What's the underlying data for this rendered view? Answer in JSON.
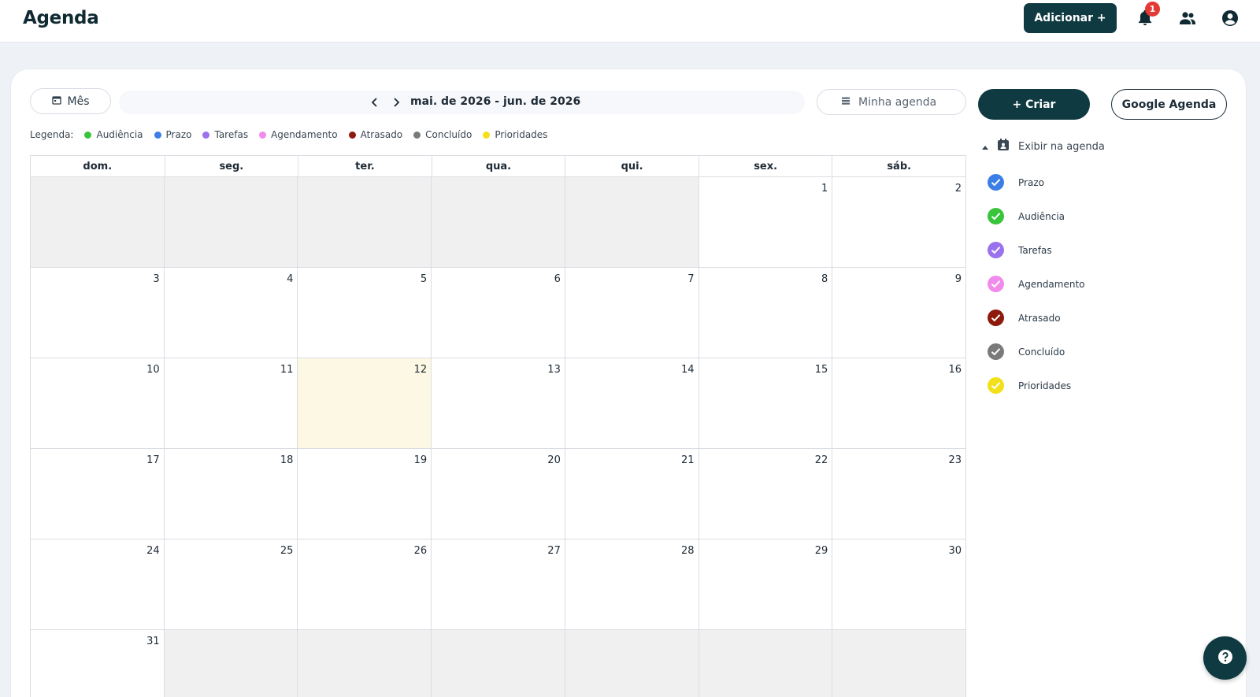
{
  "header": {
    "title": "Agenda",
    "add_button": "Adicionar +",
    "notification_count": "1"
  },
  "toolbar": {
    "view_label": "Mês",
    "range_label": "mai. de 2026 - jun. de 2026",
    "agenda_label": "Minha agenda",
    "create_label": "+ Criar",
    "google_label": "Google Agenda"
  },
  "legend": {
    "label": "Legenda:",
    "items": [
      {
        "label": "Audiência",
        "color": "#39c43b"
      },
      {
        "label": "Prazo",
        "color": "#3a7ee6"
      },
      {
        "label": "Tarefas",
        "color": "#9a72ee"
      },
      {
        "label": "Agendamento",
        "color": "#f08bec"
      },
      {
        "label": "Atrasado",
        "color": "#8e1a0e"
      },
      {
        "label": "Concluído",
        "color": "#7a7a7a"
      },
      {
        "label": "Prioridades",
        "color": "#f2e01a"
      }
    ]
  },
  "calendar": {
    "weekdays": [
      "dom.",
      "seg.",
      "ter.",
      "qua.",
      "qui.",
      "sex.",
      "sáb."
    ],
    "today": 12,
    "weeks": [
      [
        "",
        "",
        "",
        "",
        "",
        "1",
        "2"
      ],
      [
        "3",
        "4",
        "5",
        "6",
        "7",
        "8",
        "9"
      ],
      [
        "10",
        "11",
        "12",
        "13",
        "14",
        "15",
        "16"
      ],
      [
        "17",
        "18",
        "19",
        "20",
        "21",
        "22",
        "23"
      ],
      [
        "24",
        "25",
        "26",
        "27",
        "28",
        "29",
        "30"
      ],
      [
        "31",
        "",
        "",
        "",
        "",
        "",
        ""
      ]
    ]
  },
  "panel": {
    "title": "Exibir na agenda",
    "filters": [
      {
        "label": "Prazo",
        "color": "#3a7ee6"
      },
      {
        "label": "Audiência",
        "color": "#39c43b"
      },
      {
        "label": "Tarefas",
        "color": "#9a72ee"
      },
      {
        "label": "Agendamento",
        "color": "#f08bec"
      },
      {
        "label": "Atrasado",
        "color": "#8e1a0e"
      },
      {
        "label": "Concluído",
        "color": "#7a7a7a"
      },
      {
        "label": "Prioridades",
        "color": "#f2e01a"
      }
    ]
  }
}
